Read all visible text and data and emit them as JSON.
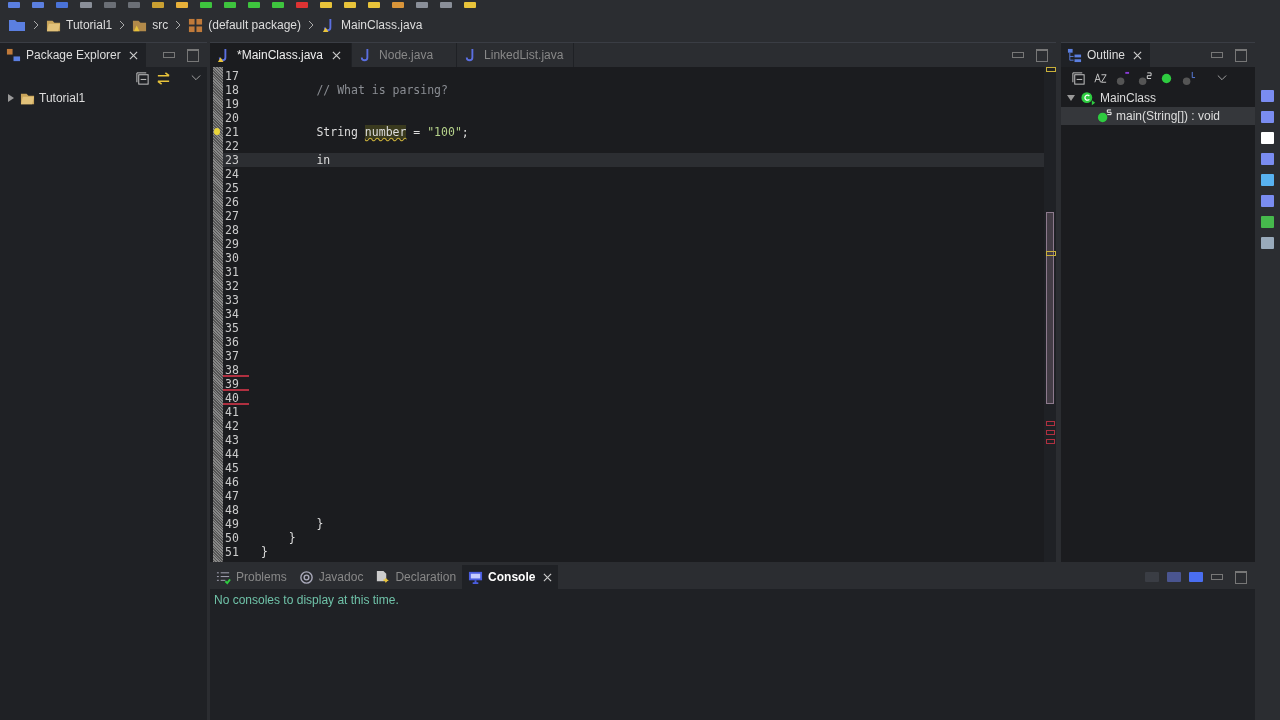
{
  "breadcrumb": [
    {
      "label": "Tutorial1",
      "kind": "project"
    },
    {
      "label": "src",
      "kind": "folder"
    },
    {
      "label": "(default package)",
      "kind": "package"
    },
    {
      "label": "MainClass.java",
      "kind": "file"
    }
  ],
  "package_explorer": {
    "title": "Package Explorer",
    "tree": [
      {
        "label": "Tutorial1",
        "expanded": false
      }
    ]
  },
  "editor": {
    "tabs": [
      {
        "label": "*MainClass.java",
        "selected": true
      },
      {
        "label": "Node.java",
        "selected": false
      },
      {
        "label": "LinkedList.java",
        "selected": false
      }
    ],
    "lines": [
      {
        "number": "17"
      },
      {
        "number": "18",
        "segments": [
          {
            "text": "        // What is parsing?",
            "kind": "comment"
          }
        ]
      },
      {
        "number": "19"
      },
      {
        "number": "20"
      },
      {
        "number": "21",
        "warning": true,
        "segments": [
          {
            "text": "        String ",
            "kind": "plain"
          },
          {
            "text": "number",
            "kind": "warned"
          },
          {
            "text": " = ",
            "kind": "plain"
          },
          {
            "text": "\"100\"",
            "kind": "string"
          },
          {
            "text": ";",
            "kind": "plain"
          }
        ]
      },
      {
        "number": "22"
      },
      {
        "number": "23",
        "current": true,
        "segments": [
          {
            "text": "        in",
            "kind": "plain"
          }
        ]
      },
      {
        "number": "24"
      },
      {
        "number": "25"
      },
      {
        "number": "26"
      },
      {
        "number": "27"
      },
      {
        "number": "28"
      },
      {
        "number": "29"
      },
      {
        "number": "30"
      },
      {
        "number": "31"
      },
      {
        "number": "32"
      },
      {
        "number": "33"
      },
      {
        "number": "34"
      },
      {
        "number": "35"
      },
      {
        "number": "36"
      },
      {
        "number": "37"
      },
      {
        "number": "38",
        "error": true
      },
      {
        "number": "39",
        "error": true
      },
      {
        "number": "40",
        "error": true
      },
      {
        "number": "41"
      },
      {
        "number": "42"
      },
      {
        "number": "43"
      },
      {
        "number": "44"
      },
      {
        "number": "45"
      },
      {
        "number": "46"
      },
      {
        "number": "47"
      },
      {
        "number": "48"
      },
      {
        "number": "49",
        "segments": [
          {
            "text": "        }",
            "kind": "plain"
          }
        ]
      },
      {
        "number": "50",
        "segments": [
          {
            "text": "    }",
            "kind": "plain"
          }
        ]
      },
      {
        "number": "51",
        "segments": [
          {
            "text": "}",
            "kind": "plain"
          }
        ]
      }
    ]
  },
  "outline": {
    "title": "Outline",
    "tree": [
      {
        "label": "MainClass",
        "expanded": true,
        "selected": false,
        "children": [
          {
            "label": "main(String[]) : void",
            "selected": true
          }
        ]
      }
    ]
  },
  "bottom_panel": {
    "tabs": [
      {
        "label": "Problems",
        "selected": false,
        "kind": "problems"
      },
      {
        "label": "Javadoc",
        "selected": false,
        "kind": "javadoc"
      },
      {
        "label": "Declaration",
        "selected": false,
        "kind": "declaration"
      },
      {
        "label": "Console",
        "selected": true,
        "kind": "console"
      }
    ],
    "message": "No consoles to display at this time."
  }
}
